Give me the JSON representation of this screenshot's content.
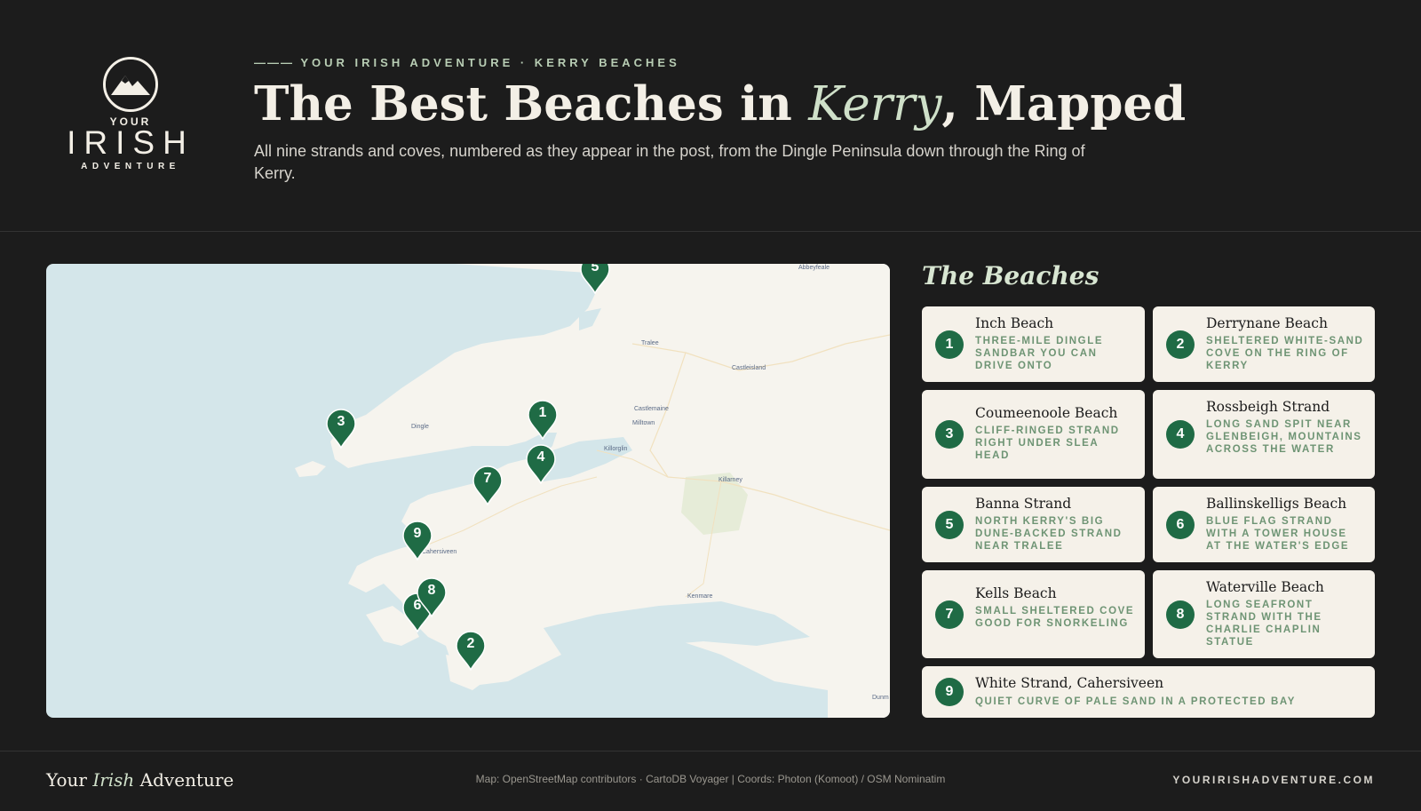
{
  "brand": {
    "logo_your": "YOUR",
    "logo_irish": "IRISH",
    "logo_adventure": "ADVENTURE",
    "accent_color": "#1f6b45",
    "logo_icon": "mountain-icon"
  },
  "header": {
    "kicker_dash": "———",
    "kicker": "YOUR IRISH ADVENTURE · KERRY BEACHES",
    "title_before": "The Best Beaches in ",
    "title_em": "Kerry",
    "title_after": ", Mapped",
    "subtitle": "All nine strands and coves, numbered as they appear in the post, from the Dingle Peninsula down through the Ring of Kerry."
  },
  "map": {
    "towns": [
      "Abbeyfeale",
      "Tralee",
      "Castleisland",
      "Castlemaine",
      "Milltown",
      "Dingle",
      "Killorglin",
      "Killarney",
      "Cahersiveen",
      "Kenmare",
      "Dunm"
    ],
    "markers": [
      "5",
      "3",
      "1",
      "4",
      "7",
      "9",
      "8",
      "6",
      "2"
    ]
  },
  "list": {
    "title": "The Beaches",
    "beaches": [
      {
        "num": "1",
        "name": "Inch Beach",
        "desc": "Three-mile Dingle sandbar you can drive onto"
      },
      {
        "num": "2",
        "name": "Derrynane Beach",
        "desc": "Sheltered white-sand cove on the Ring of Kerry"
      },
      {
        "num": "3",
        "name": "Coumeenoole Beach",
        "desc": "Cliff-ringed strand right under Slea Head"
      },
      {
        "num": "4",
        "name": "Rossbeigh Strand",
        "desc": "Long sand spit near Glenbeigh, mountains across the water"
      },
      {
        "num": "5",
        "name": "Banna Strand",
        "desc": "North Kerry's big dune-backed strand near Tralee"
      },
      {
        "num": "6",
        "name": "Ballinskelligs Beach",
        "desc": "Blue Flag strand with a tower house at the water's edge"
      },
      {
        "num": "7",
        "name": "Kells Beach",
        "desc": "Small sheltered cove good for snorkeling"
      },
      {
        "num": "8",
        "name": "Waterville Beach",
        "desc": "Long seafront strand with the Charlie Chaplin statue"
      },
      {
        "num": "9",
        "name": "White Strand, Cahersiveen",
        "desc": "Quiet curve of pale sand in a protected bay"
      }
    ]
  },
  "footer": {
    "brand_before": "Your ",
    "brand_em": "Irish",
    "brand_after": " Adventure",
    "credit": "Map: OpenStreetMap contributors · CartoDB Voyager | Coords: Photon (Komoot) / OSM Nominatim",
    "url": "YOURIRISHADVENTURE.COM"
  }
}
